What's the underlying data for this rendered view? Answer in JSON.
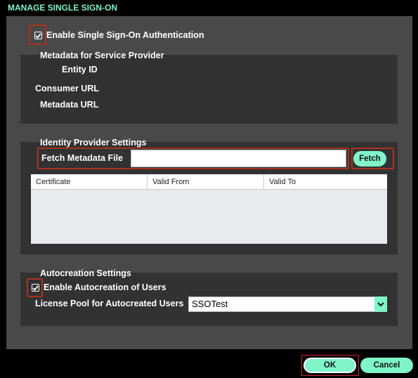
{
  "dialog": {
    "title": "MANAGE SINGLE SIGN-ON"
  },
  "sso": {
    "enable_label": "Enable Single Sign-On Authentication",
    "enabled": true
  },
  "service_provider": {
    "heading": "Metadata for Service Provider",
    "entity_id_label": "Entity ID",
    "entity_id_value": "",
    "consumer_url_label": "Consumer URL",
    "consumer_url_value": "",
    "metadata_url_label": "Metadata URL",
    "metadata_url_value": ""
  },
  "identity_provider": {
    "heading": "Identity Provider Settings",
    "fetch_label": "Fetch Metadata File",
    "fetch_input_value": "",
    "fetch_button": "Fetch",
    "table": {
      "columns": [
        "Certificate",
        "Valid From",
        "Valid To"
      ],
      "rows": []
    }
  },
  "autocreation": {
    "heading": "Autocreation Settings",
    "enable_label": "Enable Autocreation of Users",
    "enabled": true,
    "license_pool_label": "License Pool for Autocreated Users",
    "license_pool_value": "SSOTest"
  },
  "footer": {
    "ok_label": "OK",
    "cancel_label": "Cancel"
  },
  "colors": {
    "accent": "#7ff5c9",
    "panel": "#494949",
    "section": "#323232",
    "highlight": "#a8331f"
  }
}
